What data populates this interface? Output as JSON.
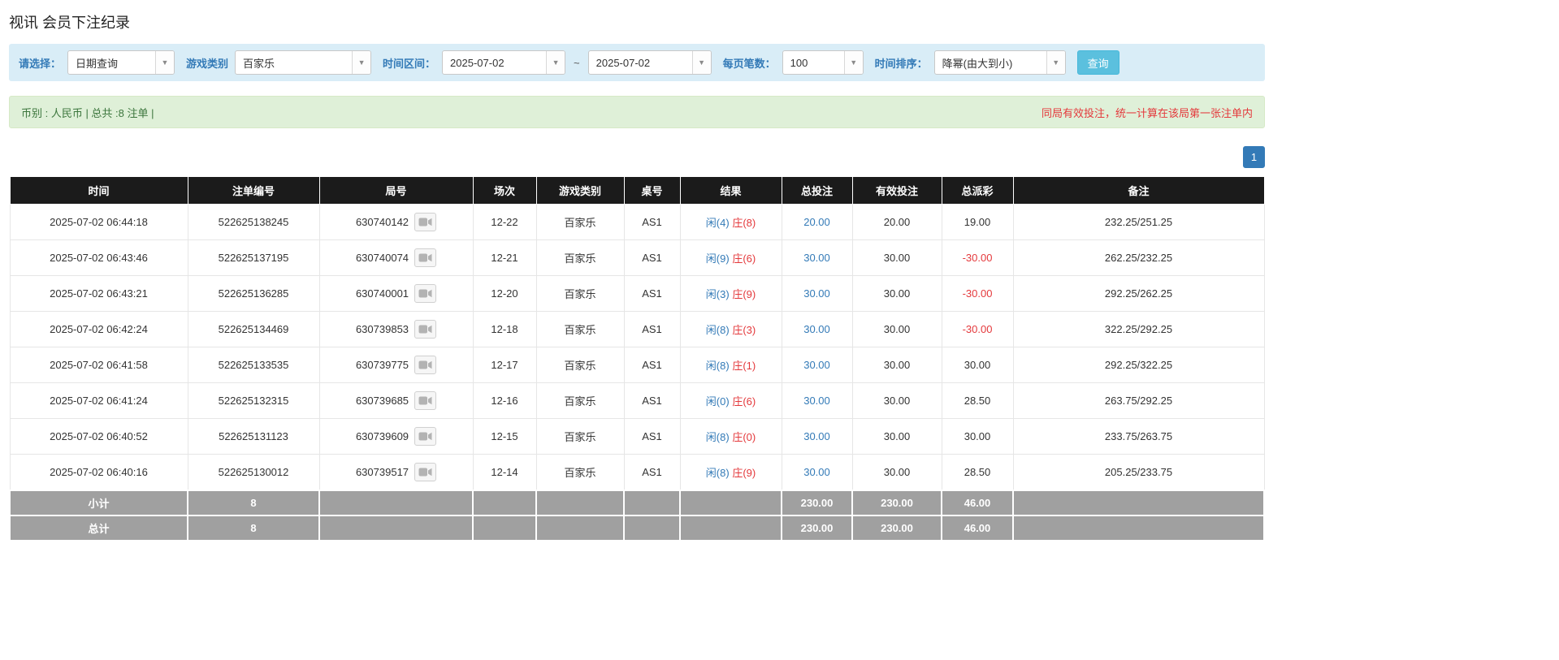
{
  "page": {
    "title": "视讯 会员下注纪录"
  },
  "colors": {
    "accent_blue": "#337ab7",
    "search_button_bg": "#5bc0de",
    "filter_bar_bg": "#d9edf7",
    "summary_bar_bg": "#dff0d8",
    "summary_text_green": "#3c763d",
    "warning_red": "#e4393c",
    "player_blue": "#337ab7",
    "banker_red": "#e4393c",
    "header_bg": "#1b1b1b",
    "footer_gray": "#a0a0a0"
  },
  "filters": {
    "select_label": "请选择：",
    "select_value": "日期查询",
    "game_type_label": "游戏类别",
    "game_type_value": "百家乐",
    "time_range_label": "时间区间：",
    "date_from": "2025-07-02",
    "tilde": "~",
    "date_to": "2025-07-02",
    "per_page_label": "每页笔数：",
    "per_page_value": "100",
    "sort_label": "时间排序：",
    "sort_value": "降幂(由大到小)",
    "search_button": "查询",
    "caret": "▼"
  },
  "summary": {
    "left": "币别 : 人民币 | 总共 :8 注单 |",
    "right": "同局有效投注，统一计算在该局第一张注单内"
  },
  "pagination": {
    "page": "1"
  },
  "table": {
    "headers": [
      "时间",
      "注单编号",
      "局号",
      "场次",
      "游戏类别",
      "桌号",
      "结果",
      "总投注",
      "有效投注",
      "总派彩",
      "备注"
    ],
    "rows": [
      {
        "time": "2025-07-02 06:44:18",
        "bet_id": "522625138245",
        "round_id": "630740142",
        "session": "12-22",
        "game": "百家乐",
        "table_no": "AS1",
        "result_player": "闲(4)",
        "result_banker": "庄(8)",
        "total_bet": "20.00",
        "valid_bet": "20.00",
        "payout": "19.00",
        "note": "232.25/251.25"
      },
      {
        "time": "2025-07-02 06:43:46",
        "bet_id": "522625137195",
        "round_id": "630740074",
        "session": "12-21",
        "game": "百家乐",
        "table_no": "AS1",
        "result_player": "闲(9)",
        "result_banker": "庄(6)",
        "total_bet": "30.00",
        "valid_bet": "30.00",
        "payout": "-30.00",
        "note": "262.25/232.25"
      },
      {
        "time": "2025-07-02 06:43:21",
        "bet_id": "522625136285",
        "round_id": "630740001",
        "session": "12-20",
        "game": "百家乐",
        "table_no": "AS1",
        "result_player": "闲(3)",
        "result_banker": "庄(9)",
        "total_bet": "30.00",
        "valid_bet": "30.00",
        "payout": "-30.00",
        "note": "292.25/262.25"
      },
      {
        "time": "2025-07-02 06:42:24",
        "bet_id": "522625134469",
        "round_id": "630739853",
        "session": "12-18",
        "game": "百家乐",
        "table_no": "AS1",
        "result_player": "闲(8)",
        "result_banker": "庄(3)",
        "total_bet": "30.00",
        "valid_bet": "30.00",
        "payout": "-30.00",
        "note": "322.25/292.25"
      },
      {
        "time": "2025-07-02 06:41:58",
        "bet_id": "522625133535",
        "round_id": "630739775",
        "session": "12-17",
        "game": "百家乐",
        "table_no": "AS1",
        "result_player": "闲(8)",
        "result_banker": "庄(1)",
        "total_bet": "30.00",
        "valid_bet": "30.00",
        "payout": "30.00",
        "note": "292.25/322.25"
      },
      {
        "time": "2025-07-02 06:41:24",
        "bet_id": "522625132315",
        "round_id": "630739685",
        "session": "12-16",
        "game": "百家乐",
        "table_no": "AS1",
        "result_player": "闲(0)",
        "result_banker": "庄(6)",
        "total_bet": "30.00",
        "valid_bet": "30.00",
        "payout": "28.50",
        "note": "263.75/292.25"
      },
      {
        "time": "2025-07-02 06:40:52",
        "bet_id": "522625131123",
        "round_id": "630739609",
        "session": "12-15",
        "game": "百家乐",
        "table_no": "AS1",
        "result_player": "闲(8)",
        "result_banker": "庄(0)",
        "total_bet": "30.00",
        "valid_bet": "30.00",
        "payout": "30.00",
        "note": "233.75/263.75"
      },
      {
        "time": "2025-07-02 06:40:16",
        "bet_id": "522625130012",
        "round_id": "630739517",
        "session": "12-14",
        "game": "百家乐",
        "table_no": "AS1",
        "result_player": "闲(8)",
        "result_banker": "庄(9)",
        "total_bet": "30.00",
        "valid_bet": "30.00",
        "payout": "28.50",
        "note": "205.25/233.75"
      }
    ],
    "footer_rows": [
      {
        "label": "小计",
        "count": "8",
        "total_bet": "230.00",
        "valid_bet": "230.00",
        "payout": "46.00"
      },
      {
        "label": "总计",
        "count": "8",
        "total_bet": "230.00",
        "valid_bet": "230.00",
        "payout": "46.00"
      }
    ]
  }
}
